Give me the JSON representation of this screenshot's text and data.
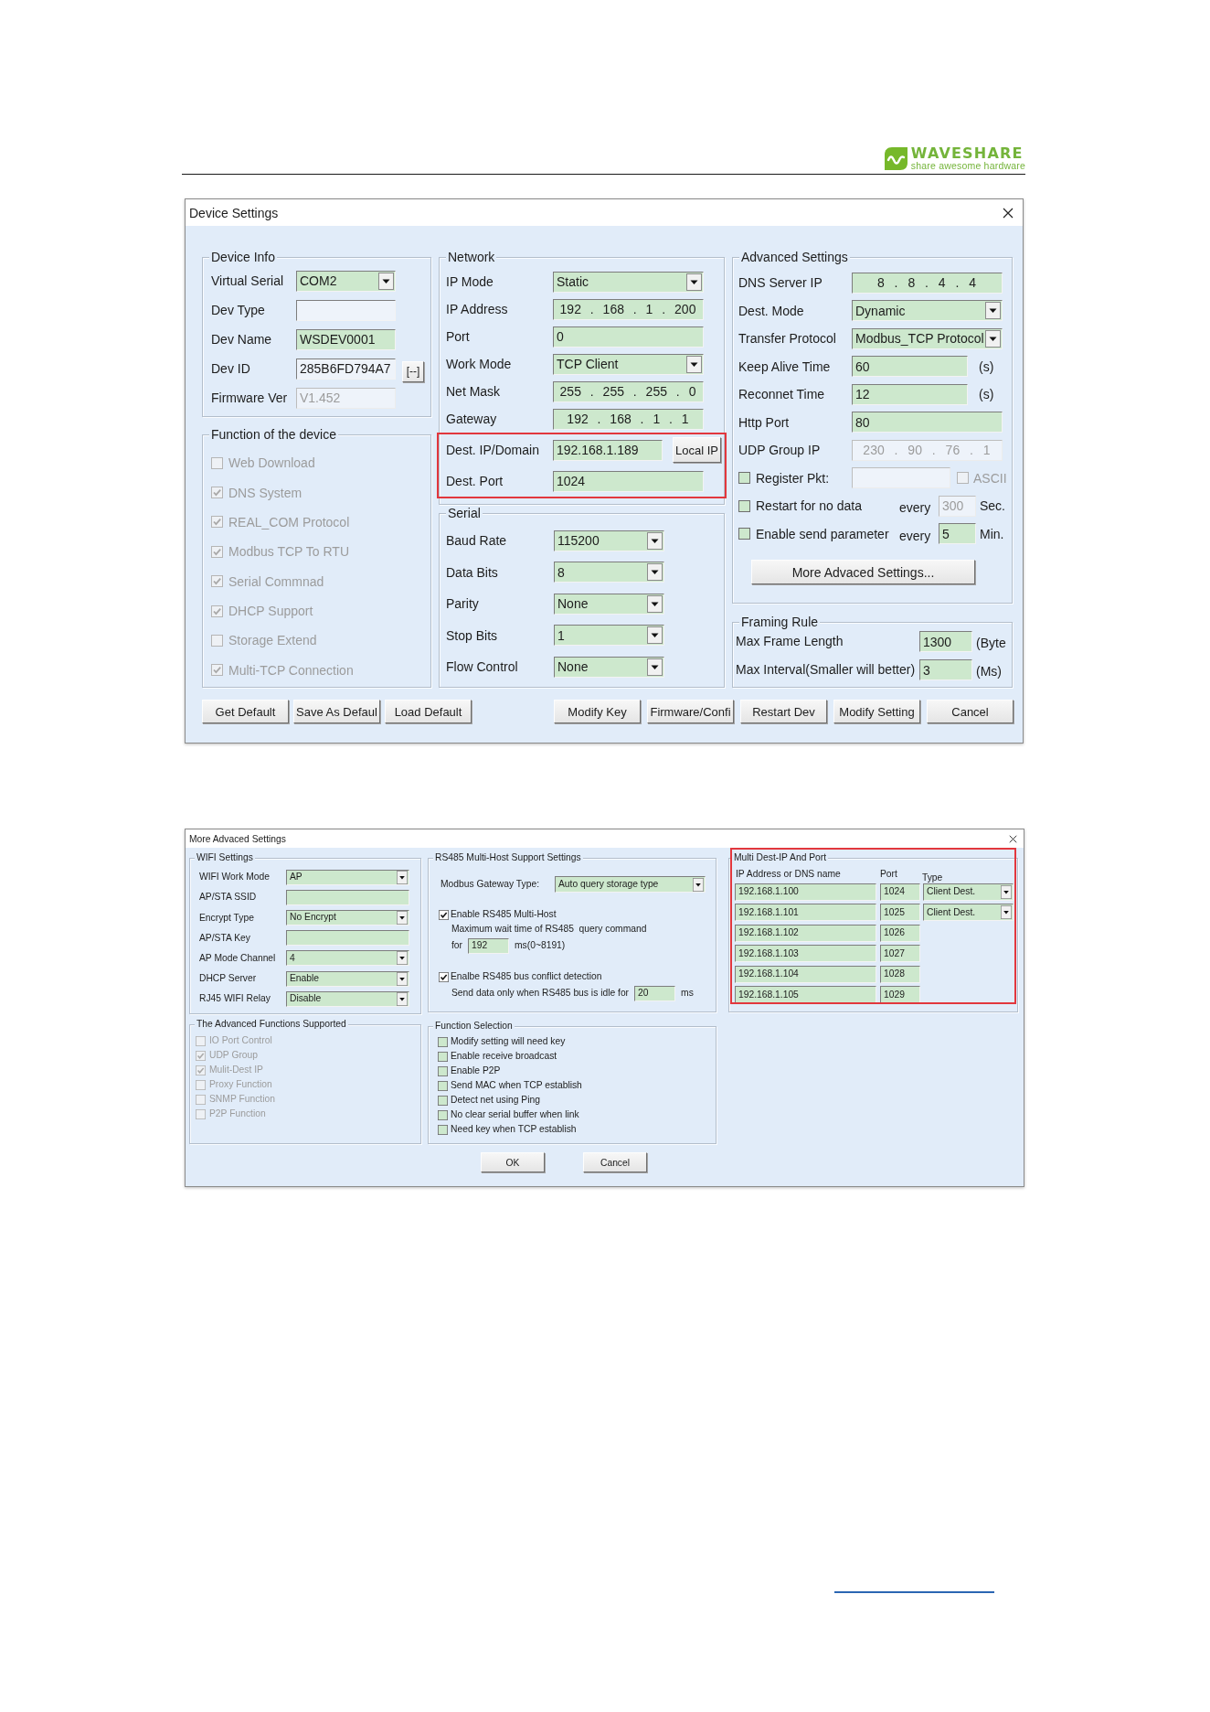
{
  "header": {
    "logo": {
      "name": "WAVESHARE",
      "tagline": "share awesome hardware"
    }
  },
  "device_settings": {
    "title": "Device Settings",
    "device_info": {
      "title": "Device Info",
      "rows": [
        {
          "label": "Virtual Serial",
          "kind": "select",
          "value": "COM2",
          "editable": true,
          "disabled": false
        },
        {
          "label": "Dev Type",
          "kind": "text",
          "editable": false,
          "disabled": false
        },
        {
          "label": "Dev Name",
          "kind": "text",
          "value": "WSDEV0001",
          "editable": true,
          "disabled": false
        },
        {
          "label": "Dev ID",
          "kind": "text",
          "value": "285B6FD794A7",
          "editable": false,
          "disabled": false,
          "button": "[--]"
        },
        {
          "label": "Firmware Ver",
          "kind": "text",
          "value": "V1.452",
          "editable": false,
          "disabled": true
        }
      ]
    },
    "functions": {
      "title": "Function of the device",
      "items": [
        {
          "label": "Web Download",
          "checked": false,
          "disabled": true
        },
        {
          "label": "DNS System",
          "checked": true,
          "disabled": true
        },
        {
          "label": "REAL_COM Protocol",
          "checked": true,
          "disabled": true
        },
        {
          "label": "Modbus TCP To RTU",
          "checked": true,
          "disabled": true
        },
        {
          "label": "Serial Commnad",
          "checked": true,
          "disabled": true
        },
        {
          "label": "DHCP Support",
          "checked": true,
          "disabled": true
        },
        {
          "label": "Storage Extend",
          "checked": false,
          "disabled": true
        },
        {
          "label": "Multi-TCP Connection",
          "checked": true,
          "disabled": true
        }
      ]
    },
    "network": {
      "title": "Network",
      "rows": [
        {
          "label": "IP Mode",
          "kind": "select",
          "value": "Static",
          "highlighted": false
        },
        {
          "label": "IP Address",
          "kind": "ip",
          "value": "192 . 168 . 1 . 200",
          "highlighted": false
        },
        {
          "label": "Port",
          "kind": "text",
          "value": "0",
          "highlighted": false
        },
        {
          "label": "Work Mode",
          "kind": "select",
          "value": "TCP Client",
          "highlighted": false
        },
        {
          "label": "Net Mask",
          "kind": "ip",
          "value": "255 . 255 . 255 . 0",
          "highlighted": false
        },
        {
          "label": "Gateway",
          "kind": "ip",
          "value": "192 . 168 . 1 . 1",
          "highlighted": false
        },
        {
          "label": "Dest. IP/Domain",
          "kind": "text",
          "value": "192.168.1.189",
          "highlighted": true,
          "button": "Local IP"
        },
        {
          "label": "Dest. Port",
          "kind": "text",
          "value": "1024",
          "highlighted": true
        }
      ]
    },
    "serial": {
      "title": "Serial",
      "rows": [
        {
          "label": "Baud Rate",
          "kind": "select",
          "value": "115200"
        },
        {
          "label": "Data Bits",
          "kind": "select",
          "value": "8"
        },
        {
          "label": "Parity",
          "kind": "select",
          "value": "None"
        },
        {
          "label": "Stop Bits",
          "kind": "select",
          "value": "1"
        },
        {
          "label": "Flow Control",
          "kind": "select",
          "value": "None"
        }
      ]
    },
    "advanced": {
      "title": "Advanced Settings",
      "rows": [
        {
          "kind": "ip",
          "label": "DNS Server IP",
          "value": "8 . 8 . 4 . 4",
          "disabled": false
        },
        {
          "kind": "select",
          "label": "Dest. Mode",
          "value": "Dynamic",
          "disabled": false
        },
        {
          "kind": "select",
          "label": "Transfer Protocol",
          "value": "Modbus_TCP Protocol",
          "disabled": false
        },
        {
          "kind": "text",
          "label": "Keep Alive Time",
          "value": "60",
          "unit": "(s)",
          "disabled": false
        },
        {
          "kind": "text",
          "label": "Reconnet Time",
          "value": "12",
          "unit": "(s)",
          "disabled": false
        },
        {
          "kind": "text",
          "label": "Http Port",
          "value": "80",
          "disabled": false
        },
        {
          "kind": "ip",
          "label": "UDP Group IP",
          "value": "230 . 90 . 76 . 1",
          "disabled": true
        },
        {
          "kind": "check_field",
          "label": "Register Pkt:",
          "checked": false,
          "disabled": true,
          "option": {
            "label": "ASCII",
            "checked": false,
            "disabled": true
          }
        },
        {
          "kind": "check_interval",
          "label": "Restart for no data",
          "checked": false,
          "every": "every",
          "value": "300",
          "disabled": true,
          "unit": "Sec."
        },
        {
          "kind": "check_interval",
          "label": "Enable send parameter",
          "checked": false,
          "every": "every",
          "value": "5",
          "disabled": false,
          "unit": "Min."
        }
      ],
      "button": "More Advaced Settings..."
    },
    "framing": {
      "title": "Framing Rule",
      "rows": [
        {
          "label": "Max Frame Length",
          "value": "1300",
          "unit": "(Byte"
        },
        {
          "label": "Max Interval(Smaller will better)",
          "value": "3",
          "unit": "(Ms)"
        }
      ]
    },
    "buttons": {
      "defaults": [
        "Get Default",
        "Save As Defaul",
        "Load Default"
      ],
      "actions": [
        "Modify Key",
        "Firmware/Confi",
        "Restart Dev",
        "Modify Setting",
        "Cancel"
      ]
    }
  },
  "more_advanced": {
    "title": "More Advaced Settings",
    "wifi": {
      "title": "WIFI Settings",
      "rows": [
        {
          "label": "WIFI Work Mode",
          "kind": "select",
          "value": "AP"
        },
        {
          "label": "AP/STA SSID",
          "kind": "text"
        },
        {
          "label": "Encrypt Type",
          "kind": "select",
          "value": "No Encrypt"
        },
        {
          "label": "AP/STA Key",
          "kind": "text"
        },
        {
          "label": "AP Mode Channel",
          "kind": "select",
          "value": "4"
        },
        {
          "label": "DHCP Server",
          "kind": "select",
          "value": "Enable"
        },
        {
          "label": "RJ45 WIFI Relay",
          "kind": "select",
          "value": "Disable"
        }
      ]
    },
    "rs485": {
      "title": "RS485 Multi-Host Support Settings",
      "items": [
        {
          "kind": "select",
          "label": "Modbus Gateway Type:",
          "value": "Auto query storage type"
        },
        {
          "kind": "checkbox",
          "label": "Enable RS485 Multi-Host",
          "checked": true
        },
        {
          "kind": "note",
          "text": "Maximum wait time of RS485  query command"
        },
        {
          "kind": "field",
          "prefix": "for",
          "value": "192",
          "suffix": "ms(0~8191)"
        },
        {
          "kind": "checkbox",
          "label": "Enalbe RS485 bus conflict detection",
          "checked": true
        },
        {
          "kind": "field",
          "prefix": "Send data only when RS485 bus is idle for",
          "value": "20",
          "suffix": "ms"
        }
      ]
    },
    "advanced_functions": {
      "title": "The Advanced Functions Supported",
      "items": [
        {
          "label": "IO Port Control",
          "checked": false,
          "disabled": true
        },
        {
          "label": "UDP Group",
          "checked": true,
          "disabled": true
        },
        {
          "label": "Mulit-Dest IP",
          "checked": true,
          "disabled": true
        },
        {
          "label": "Proxy Function",
          "checked": false,
          "disabled": true
        },
        {
          "label": "SNMP Function",
          "checked": false,
          "disabled": true
        },
        {
          "label": "P2P Function",
          "checked": false,
          "disabled": true
        }
      ]
    },
    "function_selection": {
      "title": "Function Selection",
      "items": [
        {
          "label": "Modify setting will need key",
          "checked": false
        },
        {
          "label": "Enable receive broadcast",
          "checked": false
        },
        {
          "label": "Enable P2P",
          "checked": false
        },
        {
          "label": "Send MAC when TCP establish",
          "checked": false
        },
        {
          "label": "Detect net using Ping",
          "checked": false
        },
        {
          "label": "No clear serial buffer when link",
          "checked": false
        },
        {
          "label": "Need key when TCP establish",
          "checked": false
        }
      ]
    },
    "multi_dest": {
      "title": "Multi Dest-IP And Port",
      "highlighted": true,
      "columns": [
        "IP Address or DNS name",
        "Port",
        "Type"
      ],
      "rows": [
        {
          "address": "192.168.1.100",
          "port": "1024",
          "type": "Client Dest."
        },
        {
          "address": "192.168.1.101",
          "port": "1025",
          "type": "Client Dest."
        },
        {
          "address": "192.168.1.102",
          "port": "1026"
        },
        {
          "address": "192.168.1.103",
          "port": "1027"
        },
        {
          "address": "192.168.1.104",
          "port": "1028"
        },
        {
          "address": "192.168.1.105",
          "port": "1029"
        }
      ]
    },
    "buttons": [
      "OK",
      "Cancel"
    ]
  }
}
